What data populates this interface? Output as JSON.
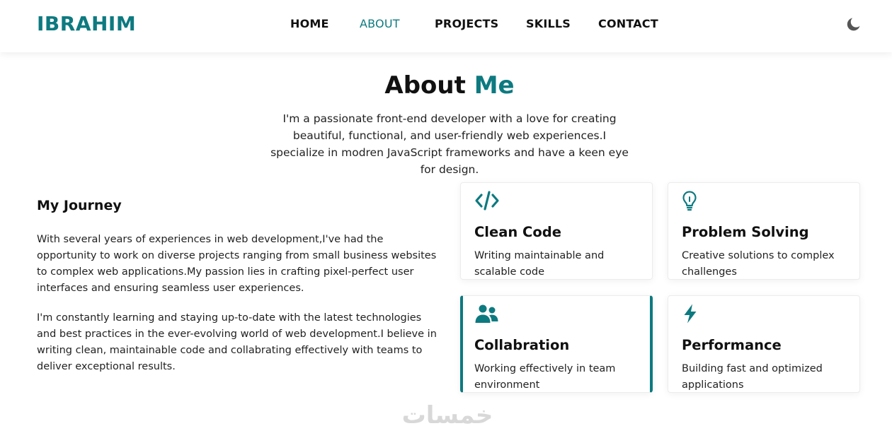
{
  "nav": {
    "logo": "IBRAHIM",
    "links": [
      {
        "label": "HOME",
        "active": false
      },
      {
        "label": "ABOUT",
        "active": true
      },
      {
        "label": "PROJECTS",
        "active": false
      },
      {
        "label": "SKILLS",
        "active": false
      },
      {
        "label": "CONTACT",
        "active": false
      }
    ],
    "theme_icon": "moon-icon"
  },
  "about": {
    "title_main": "About",
    "title_accent": "Me",
    "intro": "I'm a passionate front-end developer with a love for creating beautiful, functional, and user-friendly web experiences.I specialize in modren JavaScript frameworks and have a keen eye for design."
  },
  "journey": {
    "title": "My Journey",
    "paragraphs": [
      "With several years of experiences in web development,I've had the opportunity to work on diverse projects ranging from small business websites to complex web applications.My passion lies in crafting pixel-perfect user interfaces and ensuring seamless user experiences.",
      "I'm constantly learning and staying up-to-date with the latest technologies and best practices in the ever-evolving world of web development.I believe in writing clean, maintainable code and collabrating effectively with teams to deliver exceptional results."
    ]
  },
  "cards": [
    {
      "icon": "code-icon",
      "title": "Clean Code",
      "desc": "Writing maintainable and scalable code"
    },
    {
      "icon": "lightbulb-icon",
      "title": "Problem Solving",
      "desc": "Creative solutions to complex challenges"
    },
    {
      "icon": "users-icon",
      "title": "Collabration",
      "desc": "Working effectively in team environment"
    },
    {
      "icon": "bolt-icon",
      "title": "Performance",
      "desc": "Building fast and optimized applications"
    }
  ],
  "watermark": "خمسات",
  "colors": {
    "accent": "#0d7a80",
    "text": "#111111"
  }
}
